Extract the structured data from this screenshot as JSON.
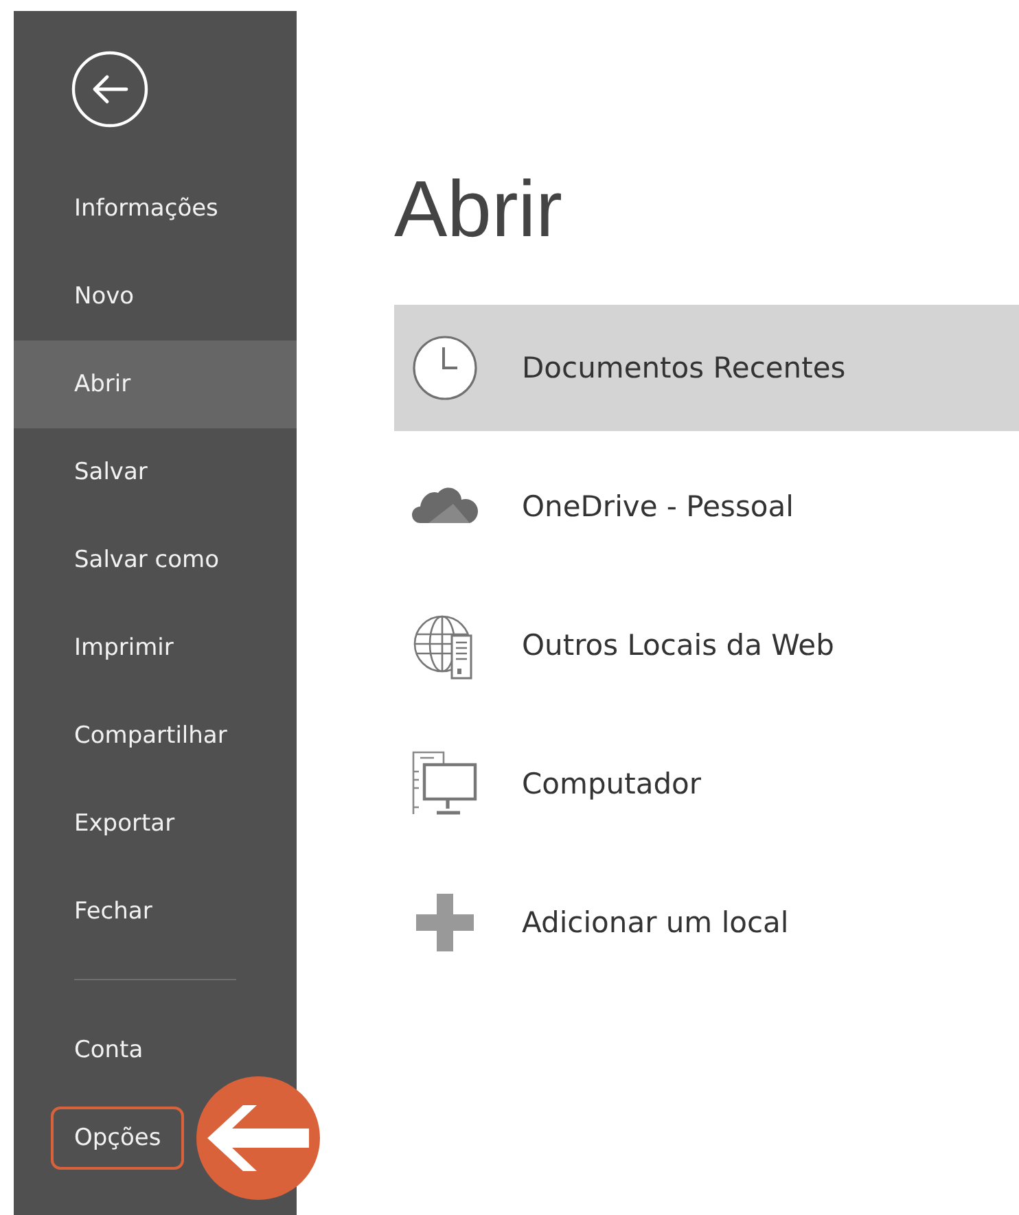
{
  "sidebar": {
    "back_button": {
      "kind": "back"
    },
    "items": [
      {
        "label": "Informações",
        "selected": false,
        "highlighted": false
      },
      {
        "label": "Novo",
        "selected": false,
        "highlighted": false
      },
      {
        "label": "Abrir",
        "selected": true,
        "highlighted": false
      },
      {
        "label": "Salvar",
        "selected": false,
        "highlighted": false
      },
      {
        "label": "Salvar como",
        "selected": false,
        "highlighted": false
      },
      {
        "label": "Imprimir",
        "selected": false,
        "highlighted": false
      },
      {
        "label": "Compartilhar",
        "selected": false,
        "highlighted": false
      },
      {
        "label": "Exportar",
        "selected": false,
        "highlighted": false
      },
      {
        "label": "Fechar",
        "selected": false,
        "highlighted": false
      }
    ],
    "bottom_items": [
      {
        "label": "Conta",
        "selected": false,
        "highlighted": false
      },
      {
        "label": "Opções",
        "selected": false,
        "highlighted": true
      }
    ]
  },
  "page_title": "Abrir",
  "places": [
    {
      "kind": "recent",
      "label": "Documentos Recentes",
      "selected": true
    },
    {
      "kind": "onedrive",
      "label": "OneDrive - Pessoal",
      "selected": false
    },
    {
      "kind": "web",
      "label": "Outros Locais da Web",
      "selected": false
    },
    {
      "kind": "computer",
      "label": "Computador",
      "selected": false
    },
    {
      "kind": "add",
      "label": "Adicionar um local",
      "selected": false
    }
  ]
}
